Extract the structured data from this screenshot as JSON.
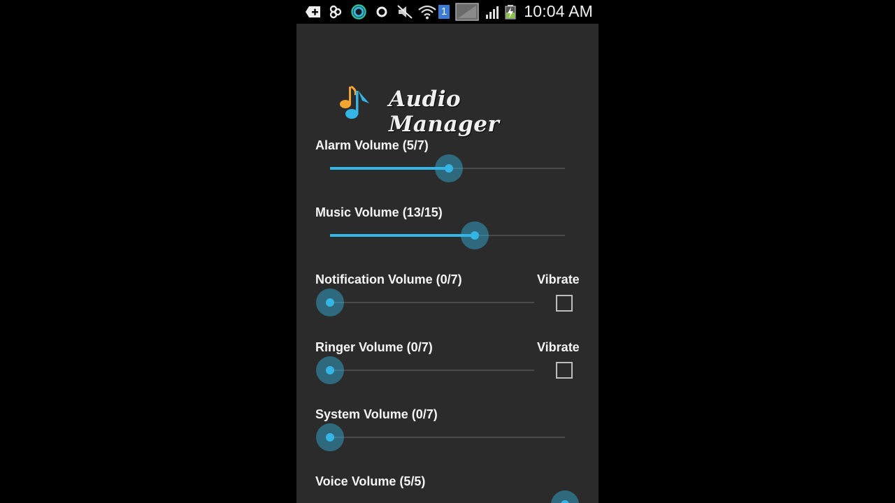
{
  "status_bar": {
    "time": "10:04 AM",
    "sim_badge": "1",
    "icons": [
      "notification-plus-icon",
      "app-notify-icon",
      "ring-icon",
      "circle-icon",
      "mute-icon",
      "wifi-icon",
      "sim-icon",
      "screenshot-icon",
      "signal-icon",
      "battery-charging-icon"
    ]
  },
  "app": {
    "title": "Audio Manager",
    "logo": "music-note-logo-icon",
    "accent_color": "#33b5e5",
    "background_color": "#2b2b2b"
  },
  "volumes": [
    {
      "label": "Alarm Volume (5/7)",
      "value": 5,
      "max": 7,
      "has_vibrate": false
    },
    {
      "label": "Music Volume (13/15)",
      "value": 13,
      "max": 15,
      "has_vibrate": false
    },
    {
      "label": "Notification Volume (0/7)",
      "value": 0,
      "max": 7,
      "has_vibrate": true,
      "vibrate_label": "Vibrate",
      "vibrate_checked": false
    },
    {
      "label": "Ringer Volume (0/7)",
      "value": 0,
      "max": 7,
      "has_vibrate": true,
      "vibrate_label": "Vibrate",
      "vibrate_checked": false
    },
    {
      "label": "System Volume (0/7)",
      "value": 0,
      "max": 7,
      "has_vibrate": false
    },
    {
      "label": "Voice Volume (5/5)",
      "value": 5,
      "max": 5,
      "has_vibrate": false
    }
  ]
}
